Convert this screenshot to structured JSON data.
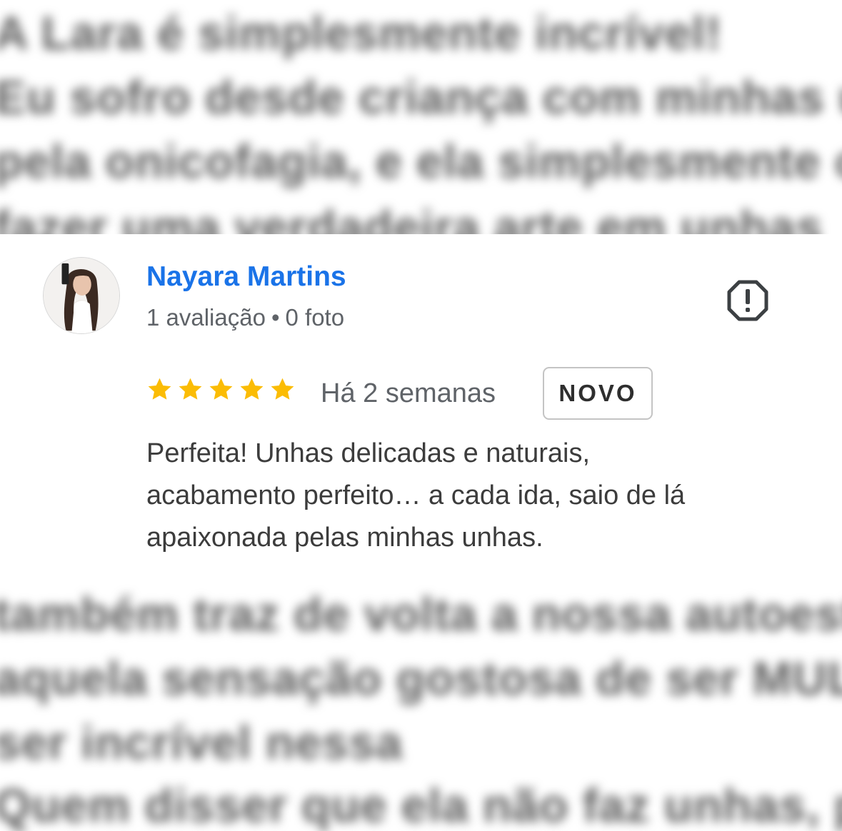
{
  "background_text": {
    "top_lines": [
      "A Lara é simplesmente incrível!",
      "Eu sofro desde criança com minhas unhas",
      "pela onicofagia, e ela simplesmente consegue",
      "fazer uma verdadeira arte em unhas"
    ],
    "bottom_lines": [
      "também traz de volta a nossa autoestima",
      "aquela sensação gostosa de ser MULHER",
      "ser incrível nessa",
      "Quem disser que ela não faz unhas, pergunte"
    ]
  },
  "review": {
    "reviewer_name": "Nayara Martins",
    "reviews_count": "1 avaliação",
    "separator": "•",
    "photos_count": "0 foto",
    "rating": 5,
    "max_rating": 5,
    "time": "Há 2 semanas",
    "badge": "NOVO",
    "text": "Perfeita! Unhas delicadas e naturais,\nacabamento perfeito… a cada ida, saio de lá\napaixonada pelas minhas unhas.",
    "icons": {
      "avatar": "avatar-photo",
      "report": "report-flag-icon",
      "star": "star-icon"
    },
    "colors": {
      "name": "#1a73e8",
      "star": "#fbbc04",
      "meta": "#5f6368"
    }
  }
}
